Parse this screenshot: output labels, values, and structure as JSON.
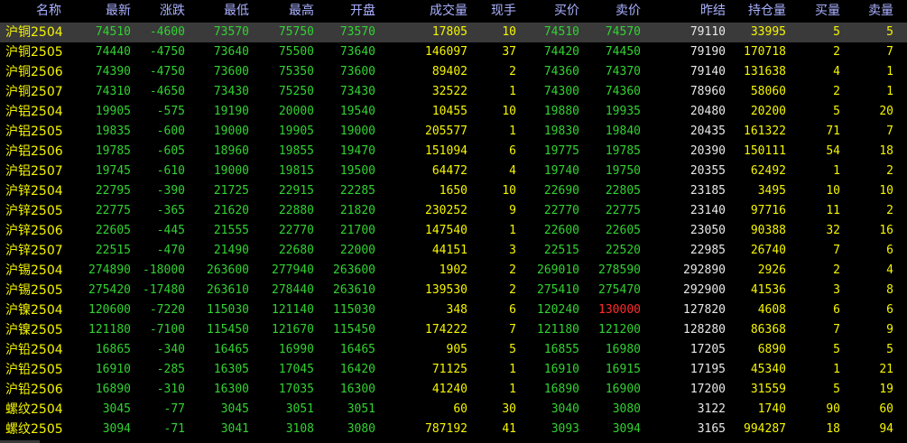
{
  "headers": {
    "name": "名称",
    "latest": "最新",
    "change": "涨跌",
    "low": "最低",
    "high": "最高",
    "open": "开盘",
    "volume": "成交量",
    "current_hand": "现手",
    "bid": "买价",
    "ask": "卖价",
    "prev_settle": "昨结",
    "open_interest": "持仓量",
    "bid_volume": "买量",
    "ask_volume": "卖量"
  },
  "colors": {
    "up": "#ff2a2a",
    "down": "#32d232",
    "neutral": "#e8e8e8",
    "highlight": "#f5f500",
    "header": "#aab1ff",
    "selected_row": "#3a3a3a",
    "background": "#000000"
  },
  "rows": [
    {
      "name": "沪铜2504",
      "latest": "74510",
      "change": "-4600",
      "low": "73570",
      "high": "75750",
      "open": "73570",
      "volume": "17805",
      "current_hand": "10",
      "bid": "74510",
      "ask": "74570",
      "prev_settle": "79110",
      "open_interest": "33995",
      "bid_volume": "5",
      "ask_volume": "5",
      "ask_state": "down",
      "selected": true
    },
    {
      "name": "沪铜2505",
      "latest": "74440",
      "change": "-4750",
      "low": "73640",
      "high": "75500",
      "open": "73640",
      "volume": "146097",
      "current_hand": "37",
      "bid": "74420",
      "ask": "74450",
      "prev_settle": "79190",
      "open_interest": "170718",
      "bid_volume": "2",
      "ask_volume": "7",
      "ask_state": "down"
    },
    {
      "name": "沪铜2506",
      "latest": "74390",
      "change": "-4750",
      "low": "73600",
      "high": "75350",
      "open": "73600",
      "volume": "89402",
      "current_hand": "2",
      "bid": "74360",
      "ask": "74370",
      "prev_settle": "79140",
      "open_interest": "131638",
      "bid_volume": "4",
      "ask_volume": "1",
      "ask_state": "down"
    },
    {
      "name": "沪铜2507",
      "latest": "74310",
      "change": "-4650",
      "low": "73430",
      "high": "75250",
      "open": "73430",
      "volume": "32522",
      "current_hand": "1",
      "bid": "74300",
      "ask": "74360",
      "prev_settle": "78960",
      "open_interest": "58060",
      "bid_volume": "2",
      "ask_volume": "1",
      "ask_state": "down"
    },
    {
      "name": "沪铝2504",
      "latest": "19905",
      "change": "-575",
      "low": "19190",
      "high": "20000",
      "open": "19540",
      "volume": "10455",
      "current_hand": "10",
      "bid": "19880",
      "ask": "19935",
      "prev_settle": "20480",
      "open_interest": "20200",
      "bid_volume": "5",
      "ask_volume": "20",
      "ask_state": "down"
    },
    {
      "name": "沪铝2505",
      "latest": "19835",
      "change": "-600",
      "low": "19000",
      "high": "19905",
      "open": "19000",
      "volume": "205577",
      "current_hand": "1",
      "bid": "19830",
      "ask": "19840",
      "prev_settle": "20435",
      "open_interest": "161322",
      "bid_volume": "71",
      "ask_volume": "7",
      "ask_state": "down"
    },
    {
      "name": "沪铝2506",
      "latest": "19785",
      "change": "-605",
      "low": "18960",
      "high": "19855",
      "open": "19470",
      "volume": "151094",
      "current_hand": "6",
      "bid": "19775",
      "ask": "19785",
      "prev_settle": "20390",
      "open_interest": "150111",
      "bid_volume": "54",
      "ask_volume": "18",
      "ask_state": "down"
    },
    {
      "name": "沪铝2507",
      "latest": "19745",
      "change": "-610",
      "low": "19000",
      "high": "19815",
      "open": "19500",
      "volume": "64472",
      "current_hand": "4",
      "bid": "19740",
      "ask": "19750",
      "prev_settle": "20355",
      "open_interest": "62492",
      "bid_volume": "1",
      "ask_volume": "2",
      "ask_state": "down"
    },
    {
      "name": "沪锌2504",
      "latest": "22795",
      "change": "-390",
      "low": "21725",
      "high": "22915",
      "open": "22285",
      "volume": "1650",
      "current_hand": "10",
      "bid": "22690",
      "ask": "22805",
      "prev_settle": "23185",
      "open_interest": "3495",
      "bid_volume": "10",
      "ask_volume": "10",
      "ask_state": "down"
    },
    {
      "name": "沪锌2505",
      "latest": "22775",
      "change": "-365",
      "low": "21620",
      "high": "22880",
      "open": "21820",
      "volume": "230252",
      "current_hand": "9",
      "bid": "22770",
      "ask": "22775",
      "prev_settle": "23140",
      "open_interest": "97716",
      "bid_volume": "11",
      "ask_volume": "2",
      "ask_state": "down"
    },
    {
      "name": "沪锌2506",
      "latest": "22605",
      "change": "-445",
      "low": "21555",
      "high": "22770",
      "open": "21700",
      "volume": "147540",
      "current_hand": "1",
      "bid": "22600",
      "ask": "22605",
      "prev_settle": "23050",
      "open_interest": "90388",
      "bid_volume": "32",
      "ask_volume": "16",
      "ask_state": "down"
    },
    {
      "name": "沪锌2507",
      "latest": "22515",
      "change": "-470",
      "low": "21490",
      "high": "22680",
      "open": "22000",
      "volume": "44151",
      "current_hand": "3",
      "bid": "22515",
      "ask": "22520",
      "prev_settle": "22985",
      "open_interest": "26740",
      "bid_volume": "7",
      "ask_volume": "6",
      "ask_state": "down"
    },
    {
      "name": "沪锡2504",
      "latest": "274890",
      "change": "-18000",
      "low": "263600",
      "high": "277940",
      "open": "263600",
      "volume": "1902",
      "current_hand": "2",
      "bid": "269010",
      "ask": "278590",
      "prev_settle": "292890",
      "open_interest": "2926",
      "bid_volume": "2",
      "ask_volume": "4",
      "ask_state": "down"
    },
    {
      "name": "沪锡2505",
      "latest": "275420",
      "change": "-17480",
      "low": "263610",
      "high": "278440",
      "open": "263610",
      "volume": "139530",
      "current_hand": "2",
      "bid": "275410",
      "ask": "275470",
      "prev_settle": "292900",
      "open_interest": "41536",
      "bid_volume": "3",
      "ask_volume": "8",
      "ask_state": "down"
    },
    {
      "name": "沪镍2504",
      "latest": "120600",
      "change": "-7220",
      "low": "115030",
      "high": "121140",
      "open": "115030",
      "volume": "348",
      "current_hand": "6",
      "bid": "120240",
      "ask": "130000",
      "prev_settle": "127820",
      "open_interest": "4608",
      "bid_volume": "6",
      "ask_volume": "6",
      "ask_state": "up"
    },
    {
      "name": "沪镍2505",
      "latest": "121180",
      "change": "-7100",
      "low": "115450",
      "high": "121670",
      "open": "115450",
      "volume": "174222",
      "current_hand": "7",
      "bid": "121180",
      "ask": "121200",
      "prev_settle": "128280",
      "open_interest": "86368",
      "bid_volume": "7",
      "ask_volume": "9",
      "ask_state": "down"
    },
    {
      "name": "沪铅2504",
      "latest": "16865",
      "change": "-340",
      "low": "16465",
      "high": "16990",
      "open": "16465",
      "volume": "905",
      "current_hand": "5",
      "bid": "16855",
      "ask": "16980",
      "prev_settle": "17205",
      "open_interest": "6890",
      "bid_volume": "5",
      "ask_volume": "5",
      "ask_state": "down"
    },
    {
      "name": "沪铅2505",
      "latest": "16910",
      "change": "-285",
      "low": "16305",
      "high": "17045",
      "open": "16420",
      "volume": "71125",
      "current_hand": "1",
      "bid": "16910",
      "ask": "16915",
      "prev_settle": "17195",
      "open_interest": "45340",
      "bid_volume": "1",
      "ask_volume": "21",
      "ask_state": "down"
    },
    {
      "name": "沪铅2506",
      "latest": "16890",
      "change": "-310",
      "low": "16300",
      "high": "17035",
      "open": "16300",
      "volume": "41240",
      "current_hand": "1",
      "bid": "16890",
      "ask": "16900",
      "prev_settle": "17200",
      "open_interest": "31559",
      "bid_volume": "5",
      "ask_volume": "19",
      "ask_state": "down"
    },
    {
      "name": "螺纹2504",
      "latest": "3045",
      "change": "-77",
      "low": "3045",
      "high": "3051",
      "open": "3051",
      "volume": "60",
      "current_hand": "30",
      "bid": "3040",
      "ask": "3080",
      "prev_settle": "3122",
      "open_interest": "1740",
      "bid_volume": "90",
      "ask_volume": "60",
      "ask_state": "down"
    },
    {
      "name": "螺纹2505",
      "latest": "3094",
      "change": "-71",
      "low": "3041",
      "high": "3108",
      "open": "3080",
      "volume": "787192",
      "current_hand": "41",
      "bid": "3093",
      "ask": "3094",
      "prev_settle": "3165",
      "open_interest": "994287",
      "bid_volume": "18",
      "ask_volume": "94",
      "ask_state": "down"
    }
  ]
}
